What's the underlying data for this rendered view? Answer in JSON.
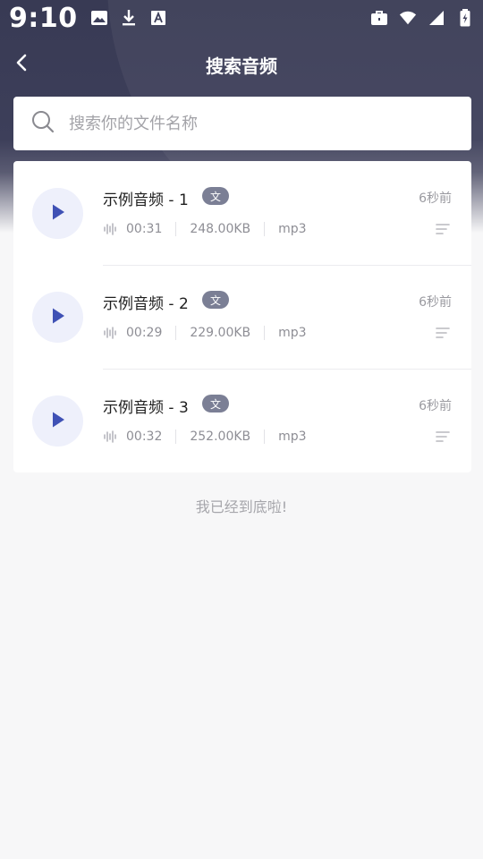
{
  "status_bar": {
    "time": "9:10"
  },
  "header": {
    "title": "搜索音频"
  },
  "search": {
    "placeholder": "搜索你的文件名称",
    "value": ""
  },
  "audio_items": [
    {
      "title": "示例音频 - 1",
      "badge": "文",
      "time_ago": "6秒前",
      "duration": "00:31",
      "size": "248.00KB",
      "format": "mp3"
    },
    {
      "title": "示例音频 - 2",
      "badge": "文",
      "time_ago": "6秒前",
      "duration": "00:29",
      "size": "229.00KB",
      "format": "mp3"
    },
    {
      "title": "示例音频 - 3",
      "badge": "文",
      "time_ago": "6秒前",
      "duration": "00:32",
      "size": "252.00KB",
      "format": "mp3"
    }
  ],
  "footer": {
    "end_text": "我已经到底啦!"
  },
  "colors": {
    "header": "#383a54",
    "accent": "#3f51b5",
    "badge": "#7b7f95",
    "background": "#f7f7f8"
  },
  "icons": {
    "status": [
      "image-icon",
      "download-icon",
      "font-icon",
      "briefcase-icon",
      "wifi-icon",
      "signal-icon",
      "battery-icon"
    ],
    "back": "chevron-left-icon",
    "search": "search-icon",
    "play": "play-icon",
    "wave": "waveform-icon",
    "menu": "menu-lines-icon"
  }
}
